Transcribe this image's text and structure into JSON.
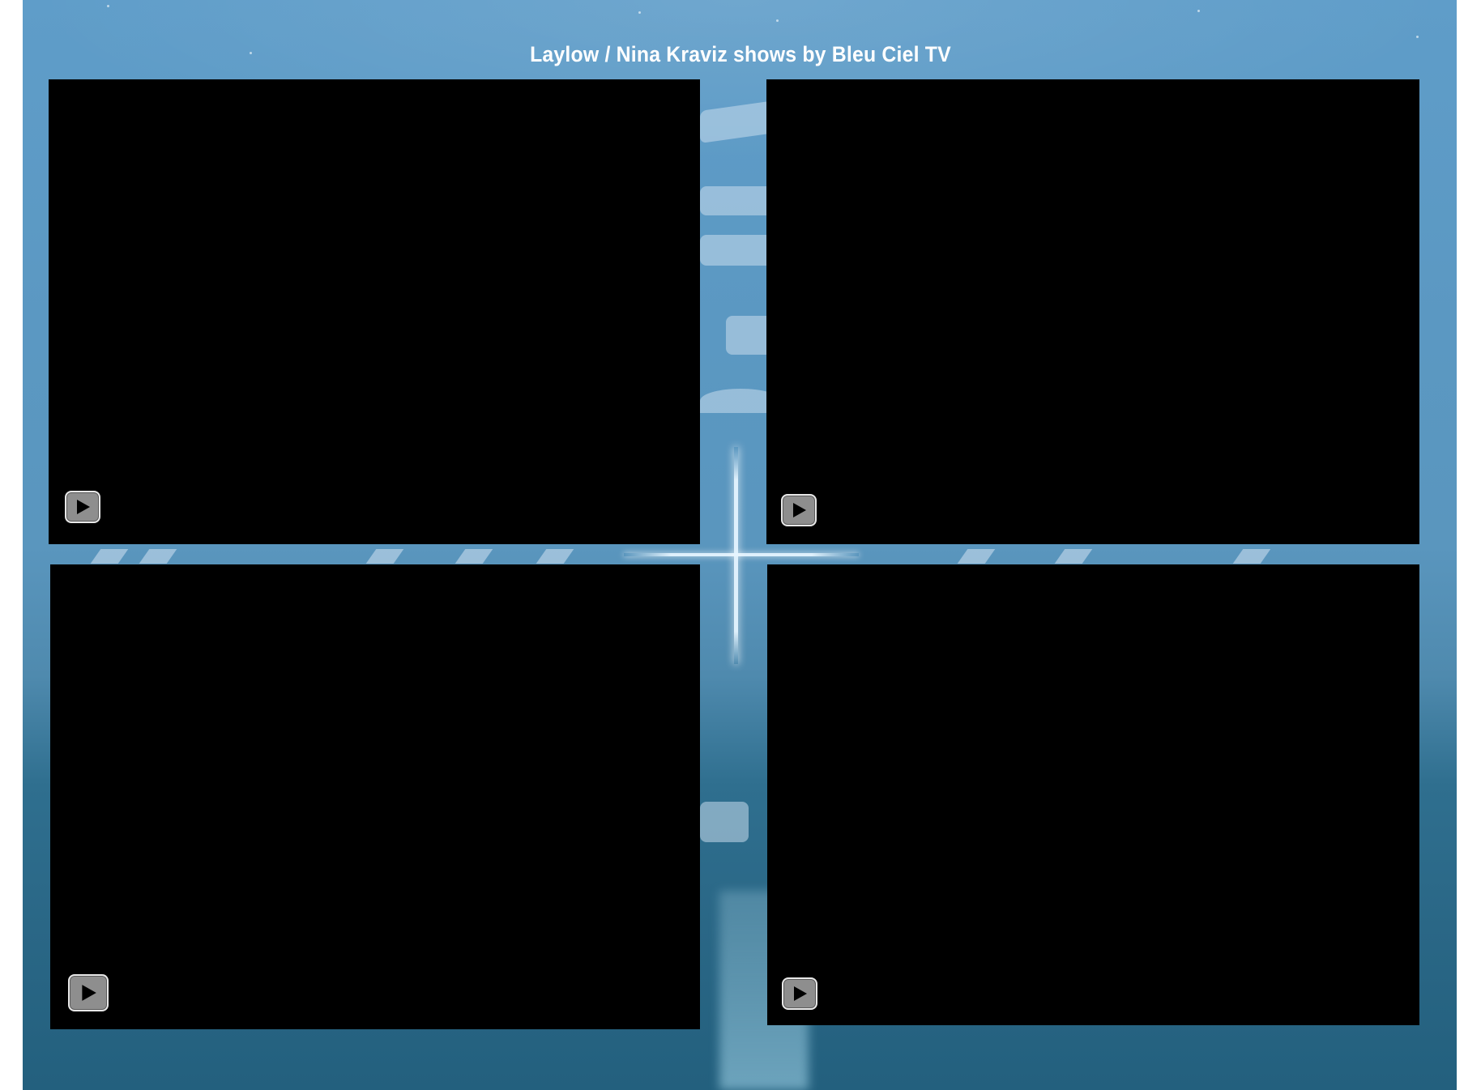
{
  "page": {
    "title": "Laylow / Nina Kraviz shows by Bleu Ciel TV",
    "background_color": "#5a96be",
    "video_background": "#000000"
  },
  "videos": [
    {
      "id": "video-1",
      "control": "play-icon"
    },
    {
      "id": "video-2",
      "control": "play-icon"
    },
    {
      "id": "video-3",
      "control": "play-icon"
    },
    {
      "id": "video-4",
      "control": "play-icon"
    }
  ]
}
